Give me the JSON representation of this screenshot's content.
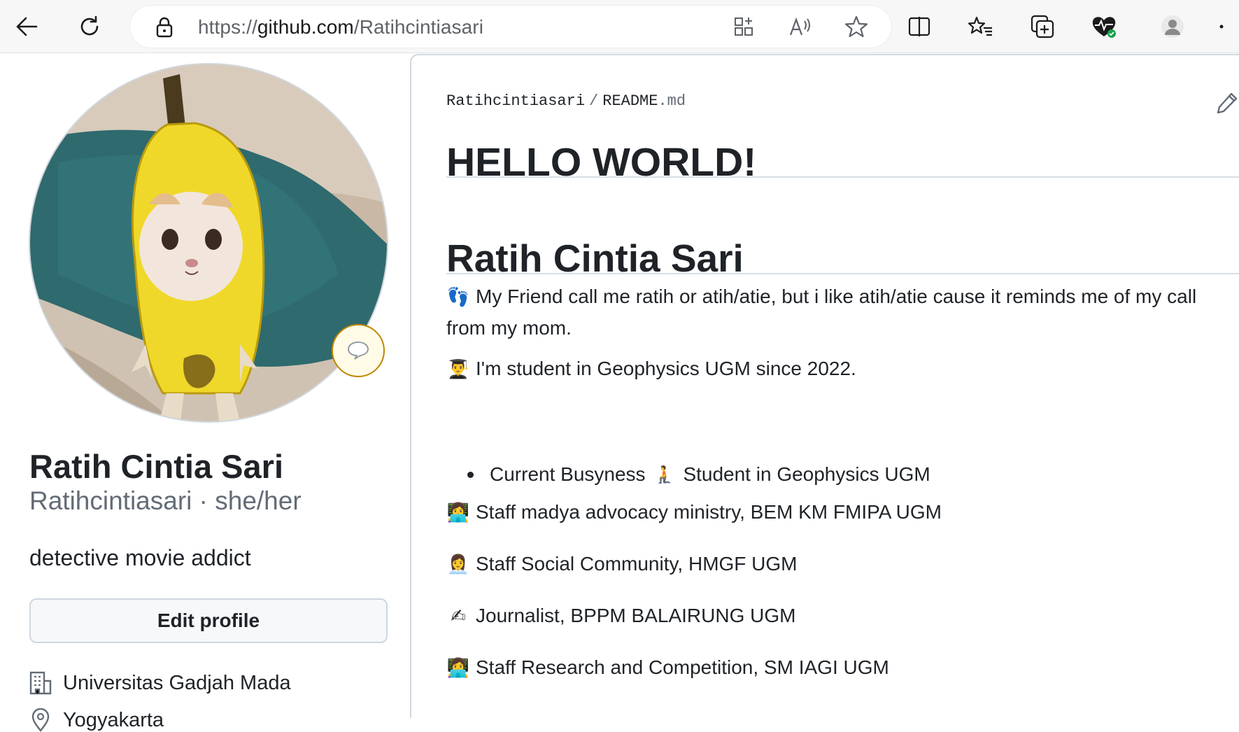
{
  "browser": {
    "url_scheme": "https://",
    "url_host": "github.com",
    "url_path": "/Ratihcintiasari"
  },
  "profile": {
    "name": "Ratih Cintia Sari",
    "handle": "Ratihcintiasari · she/her",
    "bio": "detective movie addict",
    "edit_button": "Edit profile",
    "organization": "Universitas Gadjah Mada",
    "location": "Yogyakarta"
  },
  "readme": {
    "owner": "Ratihcintiasari",
    "separator": "/",
    "file_name": "README",
    "file_ext": ".md",
    "heading1": "HELLO WORLD!",
    "heading2": "Ratih Cintia Sari",
    "para_friend_emoji": "👣",
    "para_friend": "My Friend call me ratih or atih/atie, but i like atih/atie cause it reminds me of my call from my mom.",
    "para_student_emoji": "👨‍🎓",
    "para_student": "I'm student in Geophysics UGM since 2022.",
    "bullet_label": "Current Busyness",
    "bullet_emoji": "🧎",
    "bullet_value": "Student in Geophysics UGM",
    "item1_emoji": "👩‍💻",
    "item1": "Staff madya advocacy ministry, BEM KM FMIPA UGM",
    "item2_emoji": "👩‍💼",
    "item2": "Staff Social Community, HMGF UGM",
    "item3_emoji": "✍",
    "item3": "Journalist, BPPM BALAIRUNG UGM",
    "item4_emoji": "👩‍💻",
    "item4": "Staff Research and Competition, SM IAGI UGM"
  },
  "colors": {
    "accent_badge_border": "#bf8700",
    "text_primary": "#1f2328",
    "text_muted": "#636c76"
  }
}
